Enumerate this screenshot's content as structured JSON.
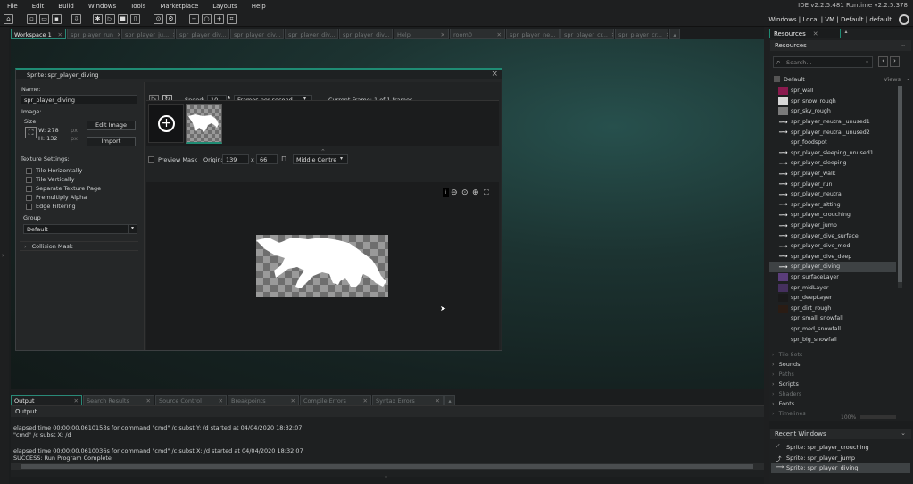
{
  "menu": [
    "File",
    "Edit",
    "Build",
    "Windows",
    "Tools",
    "Marketplace",
    "Layouts",
    "Help"
  ],
  "ide_version": "IDE v2.2.5.481 Runtime v2.2.5.378",
  "target_str": "Windows | Local | VM | Default | default",
  "workspace_tabs": [
    {
      "label": "Workspace 1",
      "active": true
    },
    {
      "label": "spr_player_run"
    },
    {
      "label": "spr_player_ju..."
    },
    {
      "label": "spr_player_div..."
    },
    {
      "label": "spr_player_div..."
    },
    {
      "label": "spr_player_div..."
    },
    {
      "label": "spr_player_div..."
    },
    {
      "label": "Help"
    },
    {
      "label": "room0"
    },
    {
      "label": "spr_player_ne..."
    },
    {
      "label": "spr_player_cr..."
    },
    {
      "label": "spr_player_cr..."
    }
  ],
  "sprite_editor": {
    "title": "Sprite: spr_player_diving",
    "name_label": "Name:",
    "name_value": "spr_player_diving",
    "image_label": "Image:",
    "size_label": "Size:",
    "width": "W: 278",
    "height": "H: 132",
    "px": "px",
    "edit_image": "Edit Image",
    "import": "Import",
    "texture_settings": "Texture Settings:",
    "options": [
      "Tile Horizontally",
      "Tile Vertically",
      "Separate Texture Page",
      "Premultiply Alpha",
      "Edge Filtering"
    ],
    "group_label": "Group",
    "group_value": "Default",
    "collision_mask": "Collision Mask",
    "speed_label": "Speed:",
    "speed_value": "10",
    "speed_unit": "Frames per second",
    "current_frame": "Current Frame: 1 of 1 frames",
    "preview_mask": "Preview Mask",
    "origin_label": "Origin:",
    "origin_x": "139",
    "origin_x_sep": "x",
    "origin_y": "66",
    "origin_preset": "Middle Centre"
  },
  "output": {
    "tabs": [
      {
        "label": "Output",
        "active": true
      },
      {
        "label": "Search Results"
      },
      {
        "label": "Source Control"
      },
      {
        "label": "Breakpoints"
      },
      {
        "label": "Compile Errors"
      },
      {
        "label": "Syntax Errors"
      }
    ],
    "header": "Output",
    "lines": [
      "elapsed time 00:00:00.0610153s for command \"cmd\" /c subst Y: /d started at 04/04/2020 18:32:07",
      "\"cmd\" /c subst X: /d",
      "",
      "elapsed time 00:00:00.0610036s for command \"cmd\" /c subst X: /d started at 04/04/2020 18:32:07",
      "SUCCESS: Run Program Complete"
    ]
  },
  "resources": {
    "tab_label": "Resources",
    "panel_title": "Resources",
    "search_placeholder": "Search...",
    "group": "Default",
    "views_label": "Views",
    "items": [
      {
        "name": "spr_wall",
        "color": "#8a1a4e"
      },
      {
        "name": "spr_snow_rough",
        "color": "#d8d8d8"
      },
      {
        "name": "spr_sky_rough",
        "color": "#7a7a7a"
      },
      {
        "name": "spr_player_neutral_unused1",
        "color": "#ffffff"
      },
      {
        "name": "spr_player_neutral_unused2",
        "color": "#ffffff"
      },
      {
        "name": "spr_foodspot",
        "color": ""
      },
      {
        "name": "spr_player_sleeping_unused1",
        "color": "#ffffff"
      },
      {
        "name": "spr_player_sleeping",
        "color": "#ffffff"
      },
      {
        "name": "spr_player_walk",
        "color": "#ffffff"
      },
      {
        "name": "spr_player_run",
        "color": "#ffffff"
      },
      {
        "name": "spr_player_neutral",
        "color": "#ffffff"
      },
      {
        "name": "spr_player_sitting",
        "color": "#ffffff"
      },
      {
        "name": "spr_player_crouching",
        "color": "#ffffff"
      },
      {
        "name": "spr_player_jump",
        "color": "#ffffff"
      },
      {
        "name": "spr_player_dive_surface",
        "color": "#ffffff"
      },
      {
        "name": "spr_player_dive_med",
        "color": "#ffffff"
      },
      {
        "name": "spr_player_dive_deep",
        "color": "#ffffff"
      },
      {
        "name": "spr_player_diving",
        "color": "#ffffff",
        "selected": true
      },
      {
        "name": "spr_surfaceLayer",
        "color": "#5a3d7a"
      },
      {
        "name": "spr_midLayer",
        "color": "#45305e"
      },
      {
        "name": "spr_deepLayer",
        "color": "#1a1a1a"
      },
      {
        "name": "spr_dirt_rough",
        "color": "#2a1c14"
      },
      {
        "name": "spr_small_snowfall",
        "color": ""
      },
      {
        "name": "spr_med_snowfall",
        "color": ""
      },
      {
        "name": "spr_big_snowfall",
        "color": ""
      }
    ],
    "groups": [
      {
        "name": "Tile Sets",
        "dim": true
      },
      {
        "name": "Sounds"
      },
      {
        "name": "Paths",
        "dim": true
      },
      {
        "name": "Scripts"
      },
      {
        "name": "Shaders",
        "dim": true
      },
      {
        "name": "Fonts"
      },
      {
        "name": "Timelines",
        "dim": true
      }
    ],
    "zoom": "100%"
  },
  "recent": {
    "title": "Recent Windows",
    "items": [
      {
        "label": "Sprite: spr_player_crouching"
      },
      {
        "label": "Sprite: spr_player_jump"
      },
      {
        "label": "Sprite: spr_player_diving",
        "selected": true
      }
    ]
  },
  "colors": {
    "accent": "#1f8c74",
    "selection": "#3e4244"
  }
}
